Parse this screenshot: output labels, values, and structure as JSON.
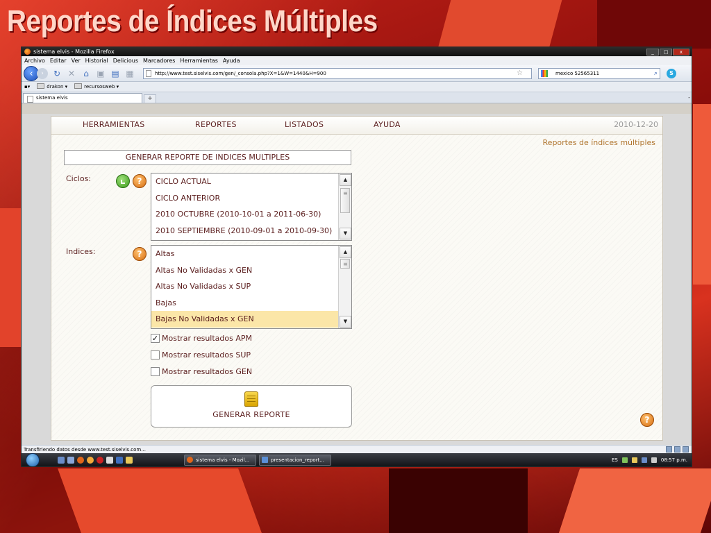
{
  "slide": {
    "title": "Reportes de Índices Múltiples"
  },
  "browser": {
    "window_title": "sistema elvis - Mozilla Firefox",
    "window_buttons": {
      "minimize": "_",
      "maximize": "□",
      "close": "x"
    },
    "menu": [
      "Archivo",
      "Editar",
      "Ver",
      "Historial",
      "Delicious",
      "Marcadores",
      "Herramientas",
      "Ayuda"
    ],
    "url": "http://www.test.siselvis.com/gen/_consola.php?X=1&W=1440&H=900",
    "search_value": "mexico 52565311",
    "bookmarks": [
      "drakon ▾",
      "recursosweb ▾"
    ],
    "tab_title": "sistema elvis",
    "new_tab": "+",
    "tab_list": "-",
    "status_text": "Transfiriendo datos desde www.test.siselvis.com..."
  },
  "site": {
    "menu": [
      "HERRAMIENTAS",
      "REPORTES",
      "LISTADOS",
      "AYUDA"
    ],
    "date": "2010-12-20",
    "page_subtitle": "Reportes de índices múltiples",
    "form_header": "GENERAR REPORTE DE INDICES MULTIPLES",
    "ciclos_label": "Ciclos:",
    "ciclos_options": [
      "CICLO ACTUAL",
      "CICLO ANTERIOR",
      "2010 OCTUBRE (2010-10-01 a 2011-06-30)",
      "2010 SEPTIEMBRE (2010-09-01 a 2010-09-30)"
    ],
    "indices_label": "Indices:",
    "indices_options": [
      "Altas",
      "Altas No Validadas x GEN",
      "Altas No Validadas x SUP",
      "Bajas",
      "Bajas No Validadas x GEN"
    ],
    "indices_selected": "Bajas No Validadas x GEN",
    "checkboxes": [
      {
        "label": "Mostrar resultados APM",
        "checked": true
      },
      {
        "label": "Mostrar resultados SUP",
        "checked": false
      },
      {
        "label": "Mostrar resultados GEN",
        "checked": false
      }
    ],
    "generate_button": "GENERAR REPORTE",
    "help_glyph": "?"
  },
  "taskbar": {
    "tasks": [
      "sistema elvis - Mozil...",
      "presentacion_report..."
    ],
    "language": "ES",
    "clock": "08:57 p.m."
  },
  "colors": {
    "site_text": "#5a1d1d",
    "subtitle": "#b0752f",
    "selected_row": "#fbe6a8",
    "slide_title": "#ffd7c9"
  }
}
